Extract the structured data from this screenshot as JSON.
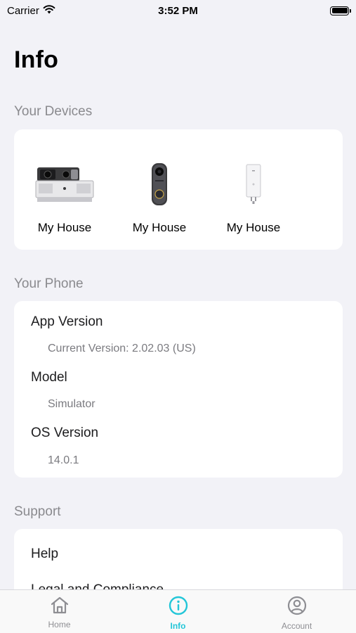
{
  "status_bar": {
    "carrier": "Carrier",
    "time": "3:52 PM",
    "icons": [
      "wifi-icon",
      "battery-icon"
    ]
  },
  "page": {
    "title": "Info"
  },
  "devices_section": {
    "header": "Your Devices",
    "devices": [
      {
        "name": "My House",
        "image": "floodlight-camera"
      },
      {
        "name": "My House",
        "image": "video-doorbell"
      },
      {
        "name": "My House",
        "image": "chime-plug"
      }
    ]
  },
  "phone_section": {
    "header": "Your Phone",
    "items": [
      {
        "label": "App Version",
        "value": "Current Version: 2.02.03 (US)"
      },
      {
        "label": "Model",
        "value": "Simulator"
      },
      {
        "label": "OS Version",
        "value": "14.0.1"
      }
    ]
  },
  "support_section": {
    "header": "Support",
    "items": [
      "Help",
      "Legal and Compliance"
    ]
  },
  "tab_bar": {
    "accent_color": "#23c6d8",
    "tabs": [
      {
        "label": "Home",
        "icon": "home-icon",
        "active": false
      },
      {
        "label": "Info",
        "icon": "info-icon",
        "active": true
      },
      {
        "label": "Account",
        "icon": "account-icon",
        "active": false
      }
    ]
  }
}
